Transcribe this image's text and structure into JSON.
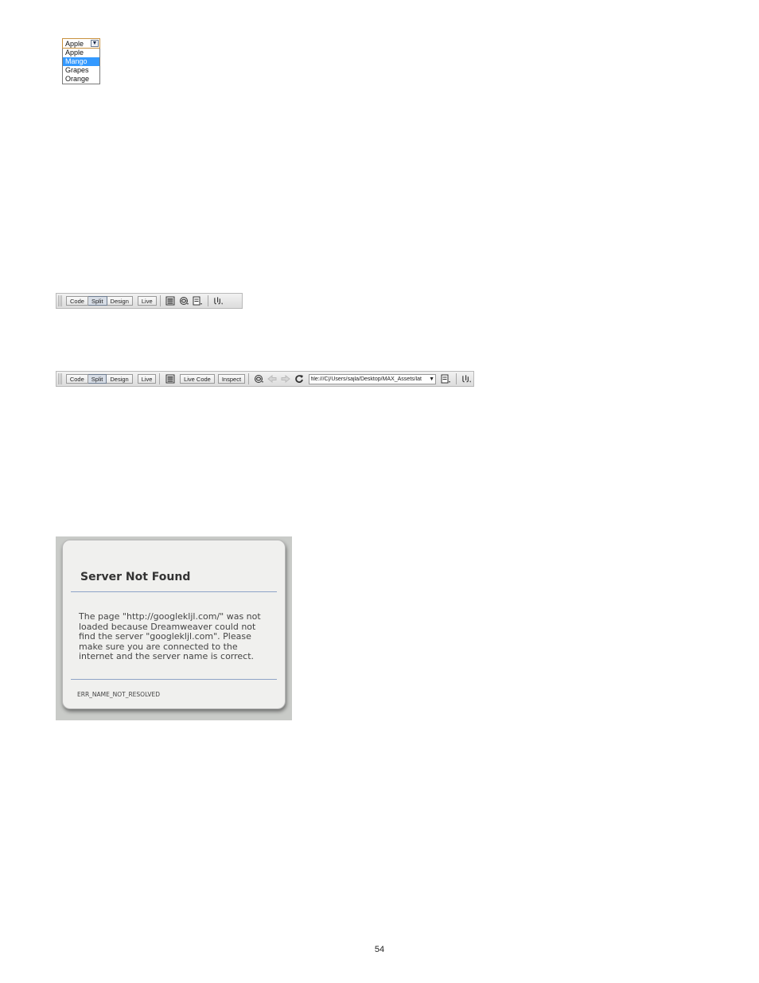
{
  "dropdown": {
    "selected": "Apple",
    "options": [
      "Apple",
      "Mango",
      "Grapes",
      "Orange"
    ],
    "highlighted": "Mango"
  },
  "toolbar1": {
    "code": "Code",
    "split": "Split",
    "design": "Design",
    "live": "Live",
    "pressed": "Split"
  },
  "toolbar2": {
    "code": "Code",
    "split": "Split",
    "design": "Design",
    "live": "Live",
    "live_code": "Live Code",
    "inspect": "Inspect",
    "address": "file:///C|/Users/sajla/Desktop/MAX_Assets/lat"
  },
  "error": {
    "title": "Server Not Found",
    "message": "The page \"http://googlekljl.com/\" was not loaded because Dreamweaver could not find the server \"googlekljl.com\". Please make sure you are connected to the internet and the server name is correct.",
    "code": "ERR_NAME_NOT_RESOLVED"
  },
  "page_number": "54"
}
